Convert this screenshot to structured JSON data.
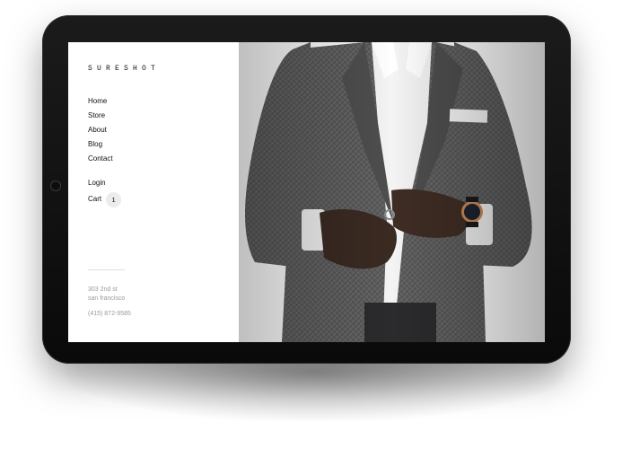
{
  "site": {
    "logo": "SURESHOT",
    "nav": [
      {
        "label": "Home"
      },
      {
        "label": "Store"
      },
      {
        "label": "About"
      },
      {
        "label": "Blog"
      },
      {
        "label": "Contact"
      }
    ],
    "account": {
      "login_label": "Login",
      "cart_label": "Cart",
      "cart_count": "1"
    },
    "address_line1": "303 2nd st",
    "address_line2": "san francisco",
    "phone": "(415) 872-9585"
  },
  "hero": {
    "image_icon": "man-in-suit-photo"
  },
  "colors": {
    "bezel": "#0d0d0d",
    "screen": "#ffffff",
    "suit": "#555555",
    "text": "#111111",
    "muted": "#9a9a9a"
  }
}
